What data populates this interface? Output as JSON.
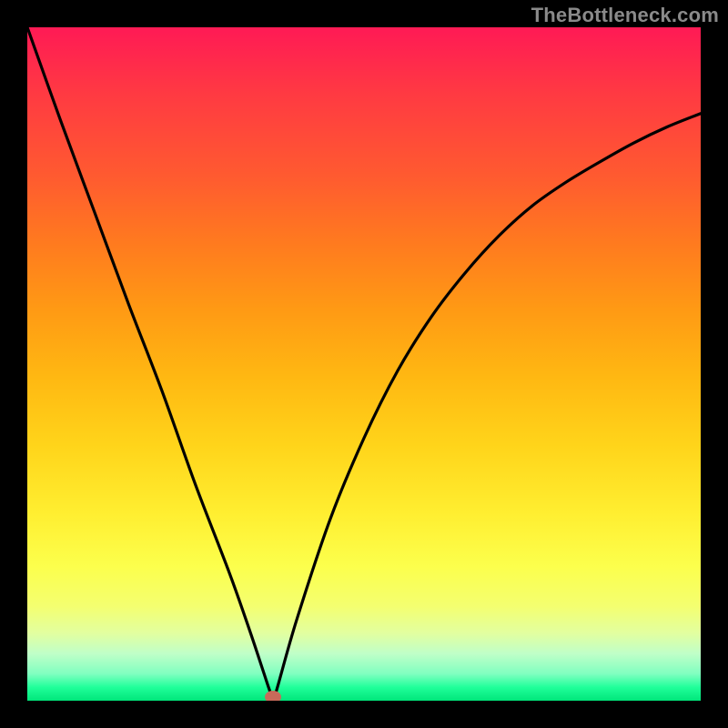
{
  "watermark": "TheBottleneck.com",
  "colors": {
    "frame": "#000000",
    "curve": "#000000",
    "dot": "#c86a5a"
  },
  "chart_data": {
    "type": "line",
    "title": "",
    "xlabel": "",
    "ylabel": "",
    "xlim": [
      0,
      100
    ],
    "ylim": [
      0,
      100
    ],
    "grid": false,
    "legend": false,
    "series": [
      {
        "name": "bottleneck-curve",
        "x": [
          0,
          5,
          10,
          15,
          20,
          25,
          30,
          33,
          35,
          36,
          36.5,
          37,
          40,
          45,
          50,
          55,
          60,
          65,
          70,
          75,
          80,
          85,
          90,
          95,
          100
        ],
        "values": [
          100,
          86,
          72.5,
          59,
          46,
          32,
          19,
          10.5,
          4.5,
          1.5,
          0.5,
          1.5,
          12,
          27,
          39,
          49,
          57,
          63.5,
          69,
          73.5,
          77,
          80,
          82.8,
          85.2,
          87.2
        ]
      }
    ],
    "markers": [
      {
        "name": "optimal-point",
        "x": 36.5,
        "y": 0.5
      }
    ]
  }
}
